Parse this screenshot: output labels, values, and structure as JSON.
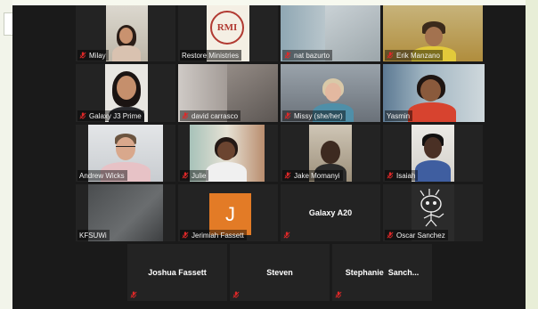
{
  "participants_row1": [
    "Milay",
    "Restore Ministries",
    "nat bazurto",
    "Erik Manzano"
  ],
  "participants_row2": [
    "Galaxy J3 Prime",
    "david carrasco",
    "Missy (she/her)",
    "Yasmin"
  ],
  "participants_row3": [
    "Andrew Wicks",
    "Julie",
    "Jake Momanyi",
    "Isaiah"
  ],
  "participants_row4": [
    "KFSUWi",
    "Jerimiah Fassett",
    "Galaxy A20",
    "Oscar Sanchez"
  ],
  "participants_row5": [
    "Joshua Fassett",
    "Steven",
    "Stephanie  Sanch..."
  ],
  "restore_logo_text": "RMI",
  "jerimiah_initial": "J",
  "colors": {
    "active_speaker_border": "#c4e07a",
    "muted_mic": "#e02828",
    "tile_bg": "#232323",
    "gallery_bg": "#1a1a1a"
  },
  "icons": {
    "muted": "muted-mic-icon"
  }
}
